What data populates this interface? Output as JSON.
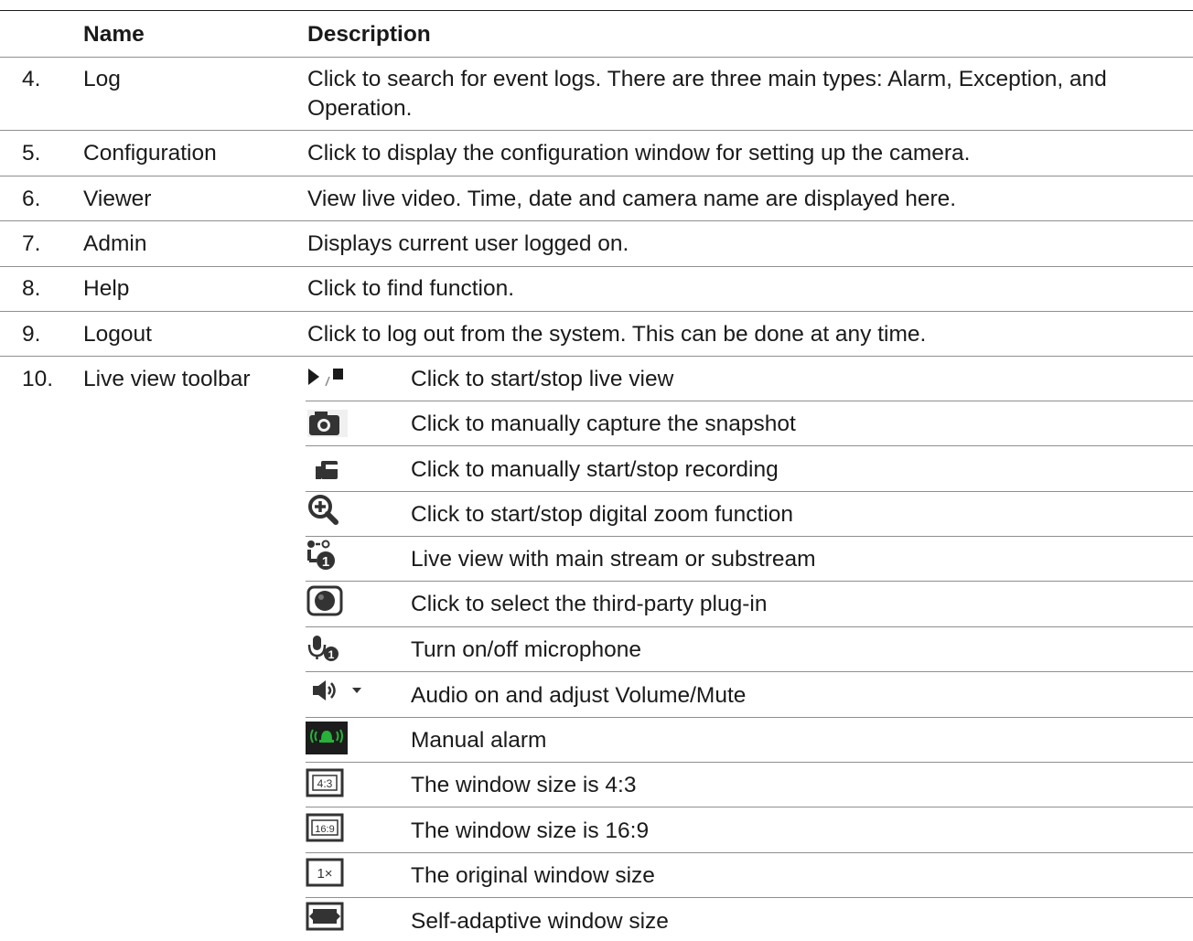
{
  "header": {
    "name": "Name",
    "description": "Description"
  },
  "rows": [
    {
      "num": "4.",
      "name": "Log",
      "desc": "Click to search for event logs. There are three main types: Alarm, Exception, and Operation."
    },
    {
      "num": "5.",
      "name": "Configuration",
      "desc": "Click to display the configuration window for setting up the camera."
    },
    {
      "num": "6.",
      "name": "Viewer",
      "desc": "View live video. Time, date and camera name are displayed here."
    },
    {
      "num": "7.",
      "name": "Admin",
      "desc": "Displays current user logged on."
    },
    {
      "num": "8.",
      "name": "Help",
      "desc": "Click to find function."
    },
    {
      "num": "9.",
      "name": "Logout",
      "desc": "Click to log out from the system. This can be done at any time."
    }
  ],
  "toolbar_row": {
    "num": "10.",
    "name": "Live view toolbar"
  },
  "toolbar": [
    {
      "icon": "play-stop-icon",
      "text": "Click to start/stop live view"
    },
    {
      "icon": "camera-snapshot-icon",
      "text": "Click to manually capture the snapshot"
    },
    {
      "icon": "video-record-icon",
      "text": "Click to manually start/stop recording"
    },
    {
      "icon": "zoom-in-icon",
      "text": "Click to start/stop digital zoom function"
    },
    {
      "icon": "stream-select-icon",
      "text": "Live view with main stream or substream"
    },
    {
      "icon": "plugin-icon",
      "text": "Click to select the third-party plug-in"
    },
    {
      "icon": "microphone-icon",
      "text": "Turn on/off microphone"
    },
    {
      "icon": "speaker-volume-icon",
      "text": "Audio on and adjust Volume/Mute"
    },
    {
      "icon": "manual-alarm-icon",
      "text": "Manual alarm"
    },
    {
      "icon": "ratio-4-3-icon",
      "text": "The window size is 4:3",
      "icon_label": "4:3"
    },
    {
      "icon": "ratio-16-9-icon",
      "text": "The window size is 16:9",
      "icon_label": "16:9"
    },
    {
      "icon": "original-size-icon",
      "text": "The original window size",
      "icon_label": "1×"
    },
    {
      "icon": "self-adaptive-icon",
      "text": "Self-adaptive window size"
    }
  ]
}
